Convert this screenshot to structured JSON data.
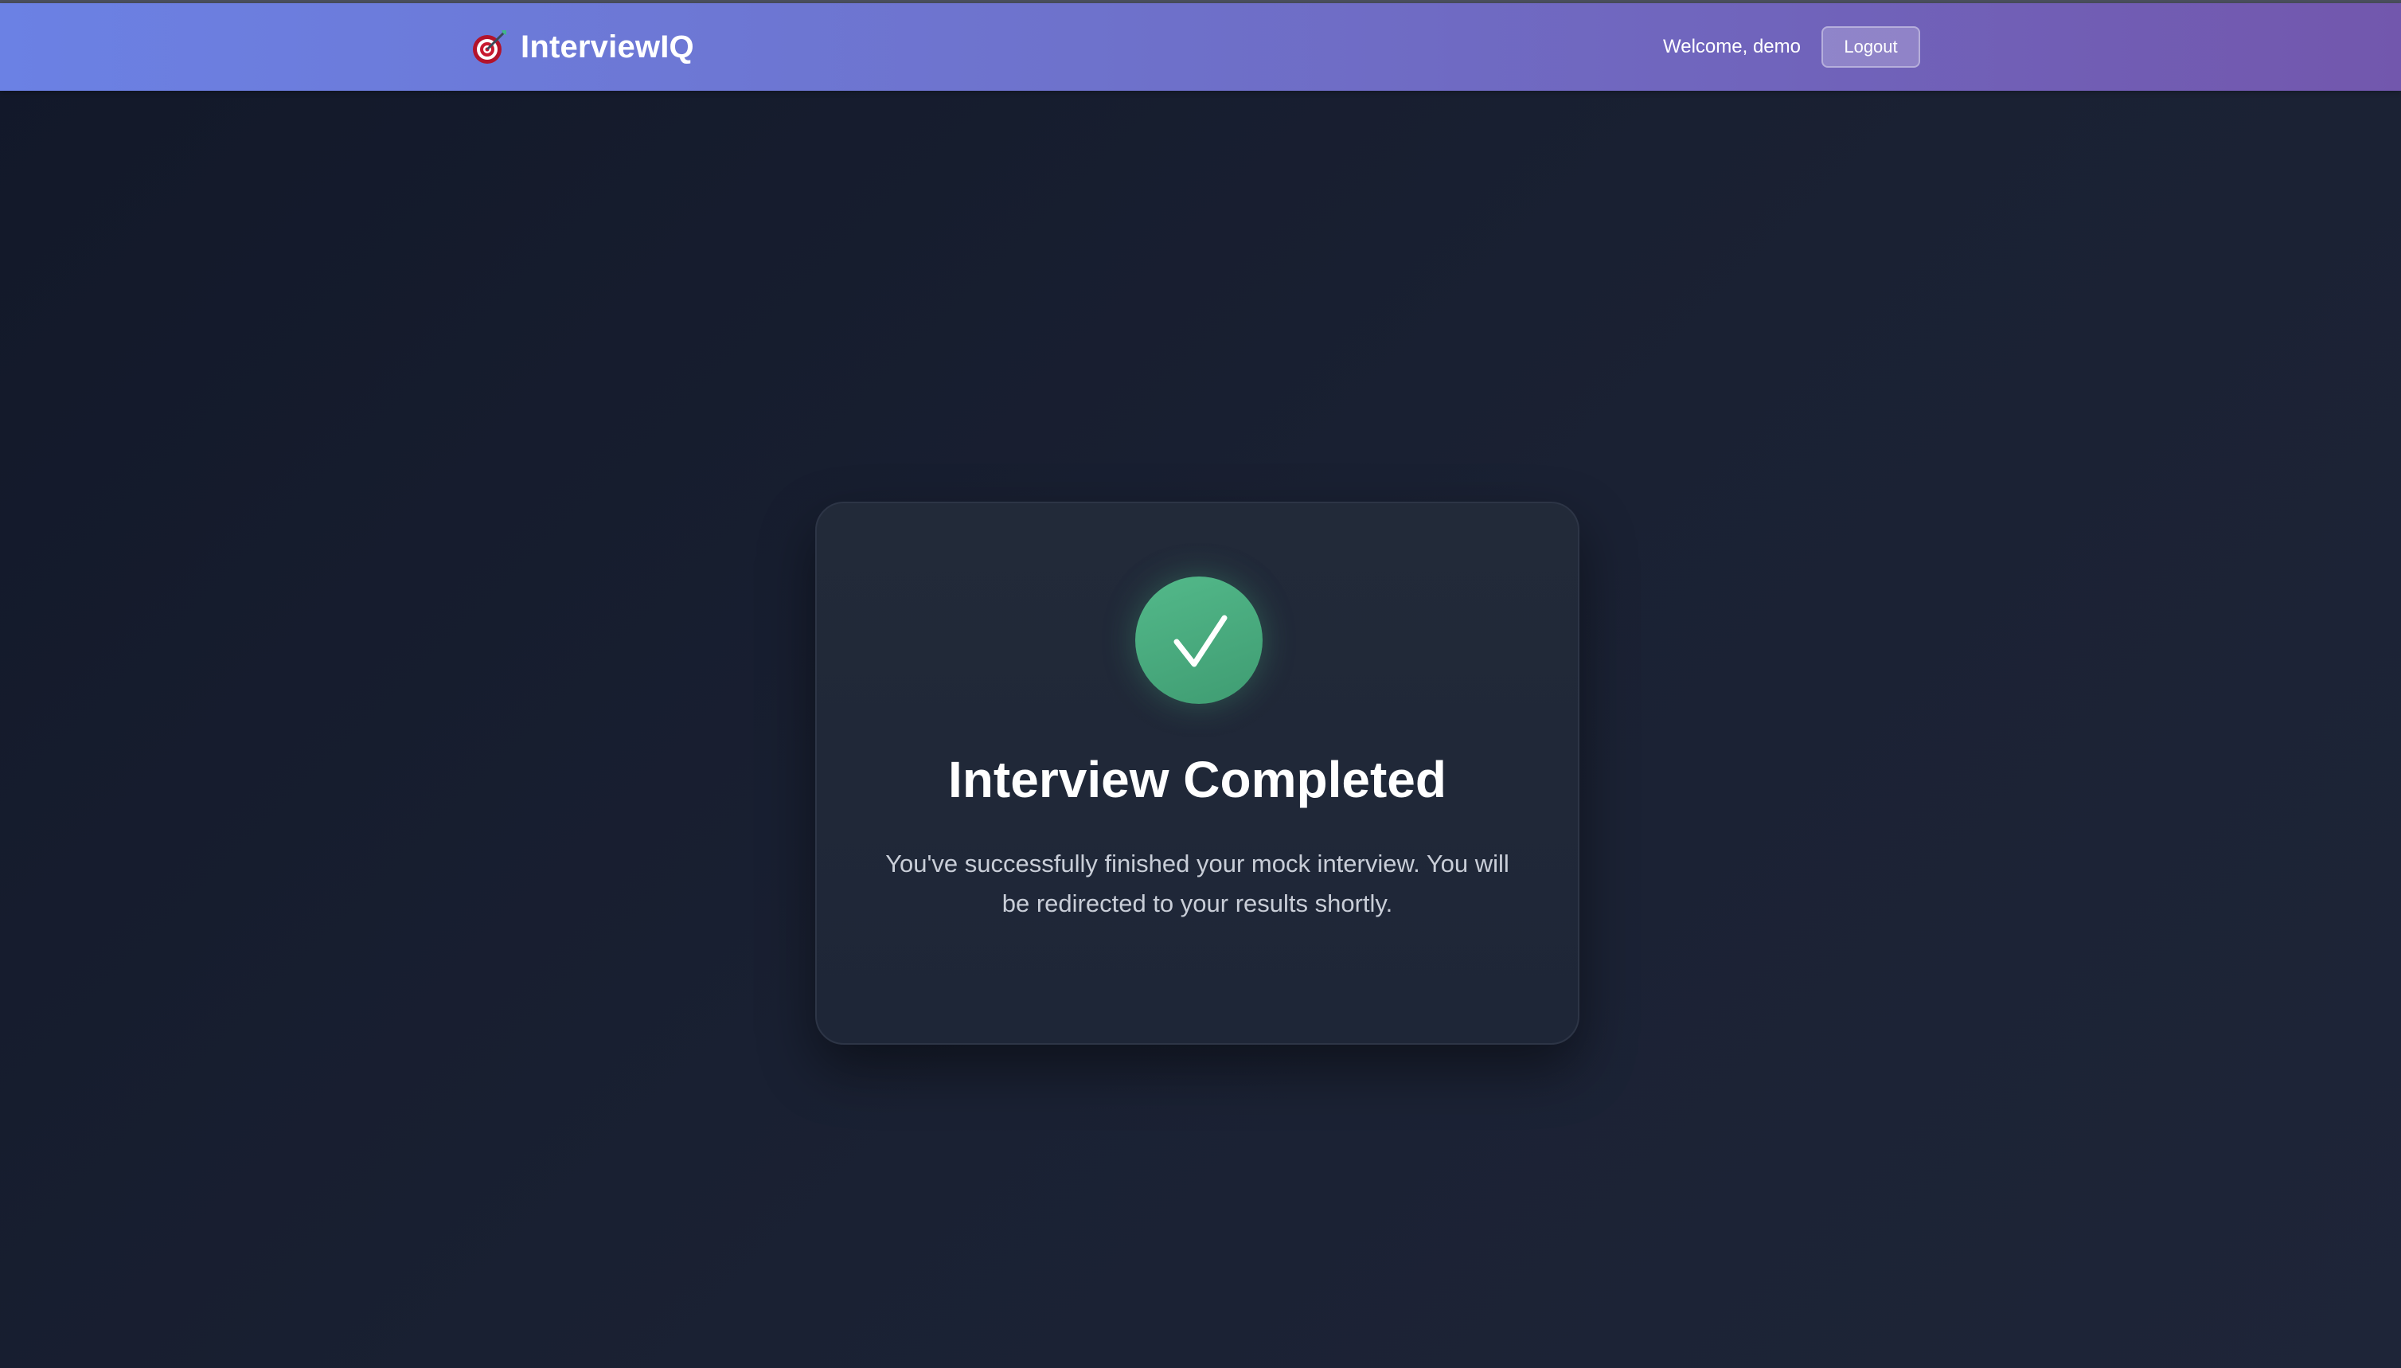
{
  "navbar": {
    "brand_name": "InterviewIQ",
    "brand_icon": "target-icon",
    "welcome_text": "Welcome, demo",
    "logout_label": "Logout"
  },
  "completion_card": {
    "icon": "checkmark-icon",
    "title": "Interview Completed",
    "message": "You've successfully finished your mock interview. You will be redirected to your results shortly."
  },
  "colors": {
    "navbar_gradient_start": "#6b81e4",
    "navbar_gradient_end": "#7257ad",
    "page_background": "#151b2c",
    "card_background": "#212938",
    "success_green": "#48ab7e"
  }
}
